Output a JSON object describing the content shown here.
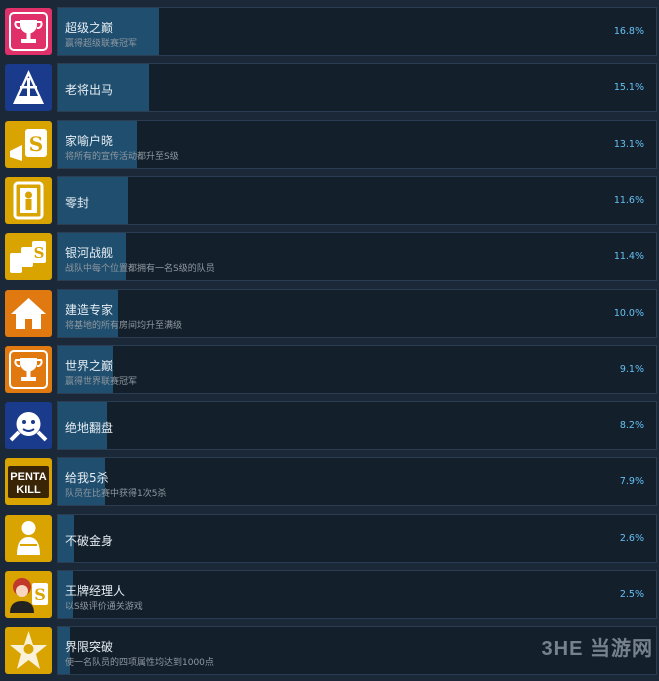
{
  "achievements": [
    {
      "title": "超级之巅",
      "desc": "赢得超级联赛冠军",
      "pct": "16.8%",
      "fraction": 0.168,
      "icon": "trophy-icon",
      "icon_bg": "#e0306a"
    },
    {
      "title": "老将出马",
      "desc": "",
      "pct": "15.1%",
      "fraction": 0.151,
      "icon": "knight-helmet-icon",
      "icon_bg": "#1a3a8c"
    },
    {
      "title": "家喻户晓",
      "desc": "将所有的宣传活动都升至S级",
      "pct": "13.1%",
      "fraction": 0.131,
      "icon": "megaphone-s-icon",
      "icon_bg": "#d9a400"
    },
    {
      "title": "零封",
      "desc": "",
      "pct": "11.6%",
      "fraction": 0.116,
      "icon": "shutout-icon",
      "icon_bg": "#d9a400"
    },
    {
      "title": "银河战舰",
      "desc": "战队中每个位置都拥有一名S级的队员",
      "pct": "11.4%",
      "fraction": 0.114,
      "icon": "s-rank-cards-icon",
      "icon_bg": "#d9a400"
    },
    {
      "title": "建造专家",
      "desc": "将基地的所有房间均升至满级",
      "pct": "10.0%",
      "fraction": 0.1,
      "icon": "house-icon",
      "icon_bg": "#e07a10"
    },
    {
      "title": "世界之巅",
      "desc": "赢得世界联赛冠军",
      "pct": "9.1%",
      "fraction": 0.091,
      "icon": "trophy-icon",
      "icon_bg": "#e07a10"
    },
    {
      "title": "绝地翻盘",
      "desc": "",
      "pct": "8.2%",
      "fraction": 0.082,
      "icon": "comeback-icon",
      "icon_bg": "#1a3a8c"
    },
    {
      "title": "给我5杀",
      "desc": "队员在比赛中获得1次5杀",
      "pct": "7.9%",
      "fraction": 0.079,
      "icon": "penta-kill-icon",
      "icon_bg": "#d9a400"
    },
    {
      "title": "不破金身",
      "desc": "",
      "pct": "2.6%",
      "fraction": 0.026,
      "icon": "golden-body-icon",
      "icon_bg": "#d9a400"
    },
    {
      "title": "王牌经理人",
      "desc": "以S级评价通关游戏",
      "pct": "2.5%",
      "fraction": 0.025,
      "icon": "manager-icon",
      "icon_bg": "#d9a400"
    },
    {
      "title": "界限突破",
      "desc": "使一名队员的四项属性均达到1000点",
      "pct": "",
      "fraction": 0.02,
      "icon": "breakthrough-icon",
      "icon_bg": "#d9a400"
    }
  ],
  "watermark": "3HE 当游网",
  "colors": {
    "bar": "#1f4e6e",
    "panel": "#13202c",
    "pct": "#66c0f4"
  }
}
